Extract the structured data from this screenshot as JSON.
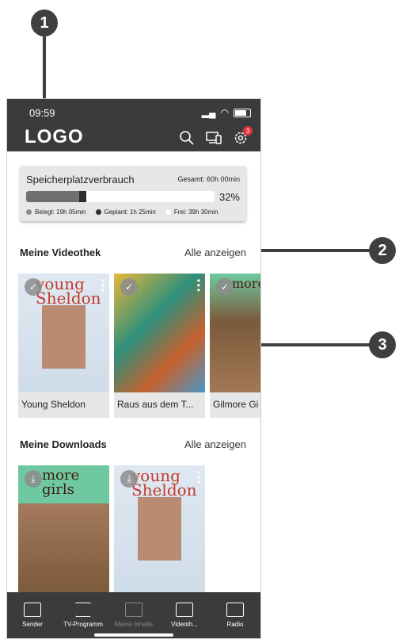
{
  "annotations": {
    "c1": "1",
    "c2": "2",
    "c3": "3"
  },
  "status": {
    "time": "09:59"
  },
  "header": {
    "logo": "LOGO",
    "notification_count": "3"
  },
  "storage": {
    "title": "Speicherplatzverbrauch",
    "total": "Gesamt: 60h 00min",
    "percent": "32%",
    "used_fraction": 0.28,
    "planned_fraction": 0.04,
    "legend": [
      "Belegt: 19h 05min",
      "Geplant: 1h 25min",
      "Frei: 39h 30min"
    ]
  },
  "videothek": {
    "title": "Meine Videothek",
    "link": "Alle anzeigen",
    "items": [
      "Young Sheldon",
      "Raus aus dem T...",
      "Gilmore Gi"
    ]
  },
  "downloads": {
    "title": "Meine Downloads",
    "link": "Alle anzeigen"
  },
  "nav": [
    "Sender",
    "TV-Programm",
    "Meine Inhalte",
    "Videoth...",
    "Radio"
  ],
  "colors": {
    "bar": "#3a3b3d",
    "accent": "#3f3f3f",
    "badge": "#e0323a"
  }
}
